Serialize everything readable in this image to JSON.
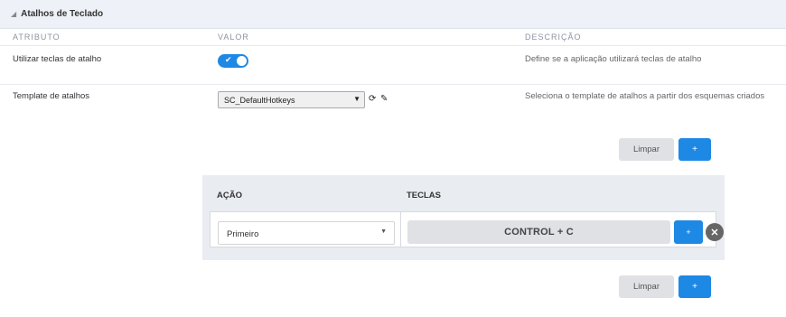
{
  "panel": {
    "title": "Atalhos de Teclado"
  },
  "columns": {
    "attribute": "ATRIBUTO",
    "value": "VALOR",
    "description": "DESCRIÇÃO"
  },
  "rows": [
    {
      "label": "Utilizar teclas de atalho",
      "description": "Define se a aplicação utilizará teclas de atalho",
      "toggle_on": true,
      "toggle_check": "✔"
    },
    {
      "label": "Template de atalhos",
      "description": "Seleciona o template de atalhos a partir dos esquemas criados",
      "selected": "SC_DefaultHotkeys",
      "icons": [
        "refresh-icon",
        "edit-pencil-icon"
      ]
    }
  ],
  "buttons": {
    "clear": "Limpar",
    "add": "+"
  },
  "hotkeys": {
    "action_header": "AÇÃO",
    "keys_header": "TECLAS",
    "items": [
      {
        "action": "Primeiro",
        "keys": "CONTROL + C"
      }
    ],
    "add_key": "+",
    "remove": "✕"
  },
  "colors": {
    "accent": "#1e88e5",
    "header_bg": "#eef1f7",
    "gray_button": "#dfe1e5"
  }
}
